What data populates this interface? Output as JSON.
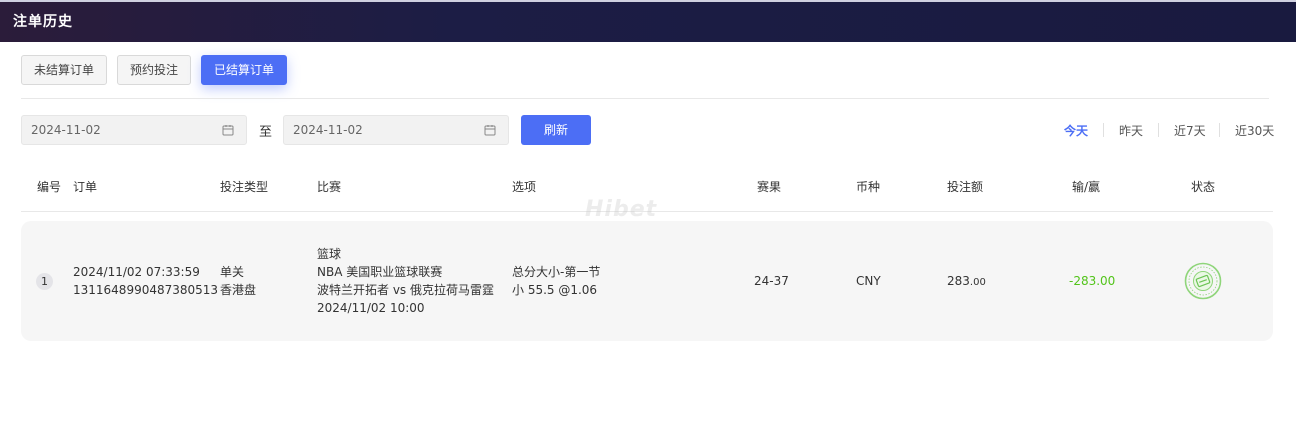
{
  "header": {
    "title": "注单历史"
  },
  "tabs": [
    {
      "label": "未结算订单",
      "active": false
    },
    {
      "label": "预约投注",
      "active": false
    },
    {
      "label": "已结算订单",
      "active": true
    }
  ],
  "filter": {
    "start_date": "2024-11-02",
    "to_label": "至",
    "end_date": "2024-11-02",
    "refresh_label": "刷新",
    "calendar_icon": "calendar-icon"
  },
  "quick_ranges": [
    {
      "label": "今天",
      "active": true
    },
    {
      "label": "昨天",
      "active": false
    },
    {
      "label": "近7天",
      "active": false
    },
    {
      "label": "近30天",
      "active": false
    }
  ],
  "table": {
    "headers": {
      "index": "编号",
      "order": "订单",
      "bet_type": "投注类型",
      "match": "比赛",
      "option": "选项",
      "result": "赛果",
      "currency": "币种",
      "stake": "投注额",
      "win_loss": "输/赢",
      "status": "状态"
    },
    "rows": [
      {
        "index": "1",
        "order_time": "2024/11/02 07:33:59",
        "order_id": "1311648990487380513",
        "bet_type": "单关",
        "odds_type": "香港盘",
        "sport": "篮球",
        "league": "NBA 美国职业篮球联赛",
        "teams": "波特兰开拓者 vs 俄克拉荷马雷霆",
        "match_time": "2024/11/02 10:00",
        "market": "总分大小-第一节",
        "selection": "小 55.5 @1.06",
        "result": "24-37",
        "currency": "CNY",
        "stake_int": "283",
        "stake_dec": ".00",
        "win_loss": "-283.00",
        "status_icon": "settled-stamp-icon"
      }
    ]
  },
  "watermark": "Hibet",
  "colors": {
    "accent": "#4c6ef5",
    "positive": "#52c41a",
    "header_bg": "#191a3f"
  }
}
